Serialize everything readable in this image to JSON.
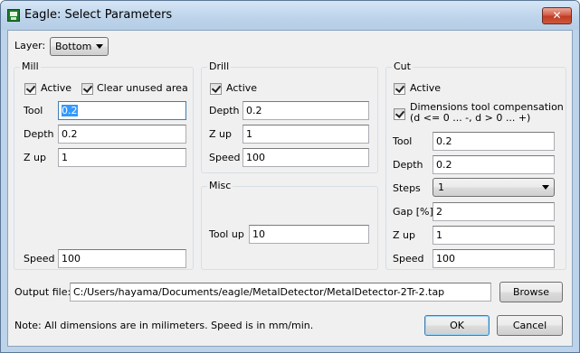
{
  "window": {
    "title": "Eagle: Select Parameters",
    "close_glyph": "✕",
    "icon": "eagle-app-icon"
  },
  "layer": {
    "label": "Layer:",
    "value": "Bottom"
  },
  "mill": {
    "title": "Mill",
    "active_label": "Active",
    "active_checked": true,
    "clear_label": "Clear unused area",
    "clear_checked": true,
    "tool_label": "Tool",
    "tool_value": "0.2",
    "depth_label": "Depth",
    "depth_value": "0.2",
    "zup_label": "Z up",
    "zup_value": "1",
    "speed_label": "Speed",
    "speed_value": "100"
  },
  "drill": {
    "title": "Drill",
    "active_label": "Active",
    "active_checked": true,
    "depth_label": "Depth",
    "depth_value": "0.2",
    "zup_label": "Z up",
    "zup_value": "1",
    "speed_label": "Speed",
    "speed_value": "100"
  },
  "misc": {
    "title": "Misc",
    "toolup_label": "Tool up",
    "toolup_value": "10"
  },
  "cut": {
    "title": "Cut",
    "active_label": "Active",
    "active_checked": true,
    "comp_label_1": "Dimensions tool compensation",
    "comp_label_2": "(d <= 0 ... -, d > 0 ... +)",
    "comp_checked": true,
    "tool_label": "Tool",
    "tool_value": "0.2",
    "depth_label": "Depth",
    "depth_value": "0.2",
    "steps_label": "Steps",
    "steps_value": "1",
    "gap_label": "Gap [%]",
    "gap_value": "2",
    "zup_label": "Z up",
    "zup_value": "1",
    "speed_label": "Speed",
    "speed_value": "100"
  },
  "output": {
    "label": "Output file:",
    "value": "C:/Users/hayama/Documents/eagle/MetalDetector/MetalDetector-2Tr-2.tap",
    "browse_label": "Browse"
  },
  "note": "Note: All dimensions are in milimeters. Speed is in mm/min.",
  "ok_label": "OK",
  "cancel_label": "Cancel"
}
